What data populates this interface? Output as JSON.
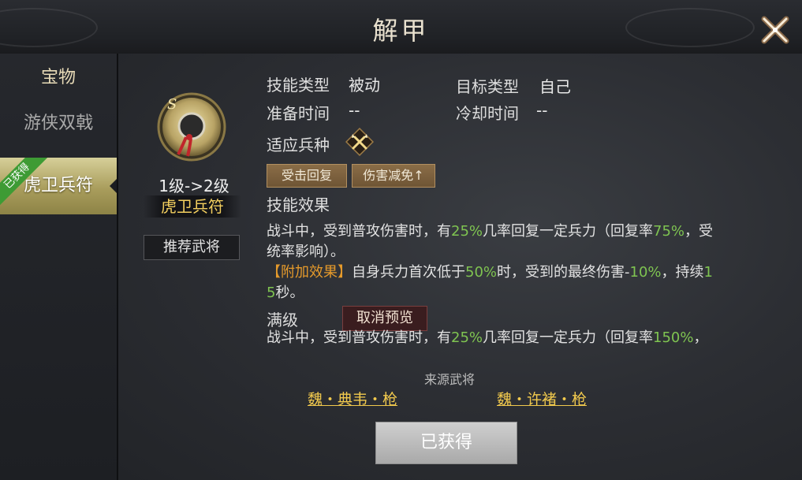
{
  "header": {
    "title": "解甲"
  },
  "sidebar": {
    "heading": "宝物",
    "items": [
      {
        "label": "游侠双戟"
      },
      {
        "label": "虎卫兵符",
        "badge": "已获得"
      }
    ]
  },
  "item": {
    "icon_letter": "S",
    "level_text": "1级->2级",
    "name": "虎卫兵符",
    "recommend_label": "推荐武将"
  },
  "skill": {
    "type_label": "技能类型",
    "type_value": "被动",
    "target_label": "目标类型",
    "target_value": "自己",
    "prep_label": "准备时间",
    "prep_value": "--",
    "cooldown_label": "冷却时间",
    "cooldown_value": "--",
    "troop_label": "适应兵种",
    "tags": [
      "受击回复",
      "伤害减免↑"
    ],
    "effect_label": "技能效果",
    "effect": {
      "p1_a": "战斗中，受到普攻伤害时，有",
      "p1_pct1": "25%",
      "p1_b": "几率回复一定兵力（回复率",
      "p1_pct2": "75%",
      "p1_c": "，受",
      "p2": "统率影响）。",
      "p3_tag": "【附加效果】",
      "p3_a": "自身兵力首次低于",
      "p3_pct1": "50%",
      "p3_b": "时，受到的最终伤害-",
      "p3_pct2": "10%",
      "p3_c": "，持续",
      "p3_d": "1",
      "p4_a": "5",
      "p4_b": "秒。"
    },
    "max_label": "满级",
    "cancel_preview": "取消预览",
    "max_effect": {
      "a": "战斗中，受到普攻伤害时，有",
      "pct1": "25%",
      "b": "几率回复一定兵力（回复率",
      "pct2": "150%",
      "c": "，"
    }
  },
  "source": {
    "label": "来源武将",
    "generals": [
      "魏・典韦・枪",
      "魏・许褚・枪"
    ]
  },
  "action": {
    "obtained": "已获得"
  },
  "colors": {
    "gold": "#f3cf5f",
    "green": "#7fc451",
    "orange": "#e59a2b",
    "badge_green": "#3e9b34"
  }
}
